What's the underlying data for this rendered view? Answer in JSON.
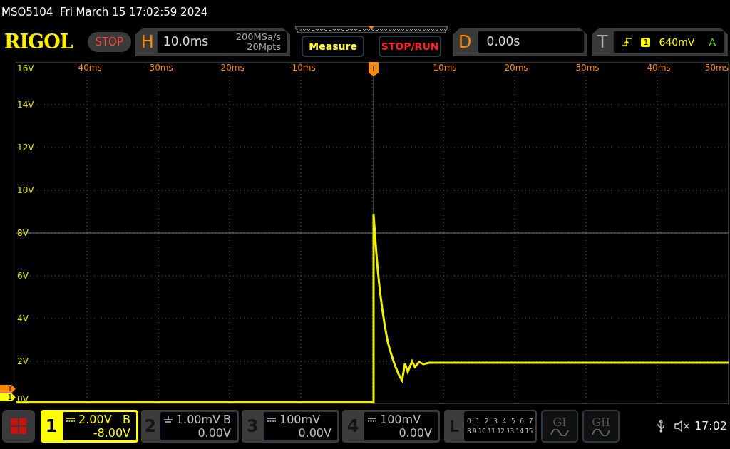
{
  "title": "MSO5104  Fri March 15 17:02:59 2024",
  "logo": "RIGOL",
  "run_state": {
    "label": "STOP",
    "kind": "stop"
  },
  "horizontal": {
    "letter": "H",
    "scale": "10.0ms",
    "sample_rate": "200MSa/s",
    "memory_depth": "20Mpts"
  },
  "buttons": [
    {
      "label": "Measure",
      "kind": "measure"
    },
    {
      "label": "STOP/RUN",
      "kind": "stoprun"
    }
  ],
  "delay": {
    "letter": "D",
    "value": "0.00s"
  },
  "trigger": {
    "letter": "T",
    "source": "1",
    "level": "640mV",
    "mode": "A"
  },
  "trigger_position": "T",
  "x_labels": [
    "-40ms",
    "-30ms",
    "-20ms",
    "-10ms",
    "10ms",
    "20ms",
    "30ms",
    "40ms",
    "50ms"
  ],
  "y_labels": [
    "16V",
    "14V",
    "12V",
    "10V",
    "8V",
    "6V",
    "4V",
    "2V",
    "0V"
  ],
  "markers": [
    {
      "label": "T",
      "kind": "trigger"
    },
    {
      "label": "1",
      "kind": "channel"
    }
  ],
  "channels": [
    {
      "number": "1",
      "kind": "dc",
      "scale": "2.00V",
      "bandwidth": "B",
      "offset": "-8.00V",
      "selected": true
    },
    {
      "number": "2",
      "kind": "gnd",
      "scale": "1.00mV",
      "bandwidth": "B",
      "offset": "0.00V",
      "selected": false
    },
    {
      "number": "3",
      "kind": "dc",
      "scale": "100mV",
      "offset": "0.00V",
      "selected": false
    },
    {
      "number": "4",
      "kind": "dc",
      "scale": "100mV",
      "offset": "0.00V",
      "selected": false
    }
  ],
  "logic": {
    "letter": "L",
    "row_1": [
      "0",
      "1",
      "2",
      "3",
      "4",
      "5",
      "6",
      "7"
    ],
    "row_2": [
      "8",
      "9",
      "10",
      "11",
      "12",
      "13",
      "14",
      "15"
    ]
  },
  "generators": [
    {
      "label": "GI"
    },
    {
      "label": "GII"
    }
  ],
  "clock": "17:02"
}
